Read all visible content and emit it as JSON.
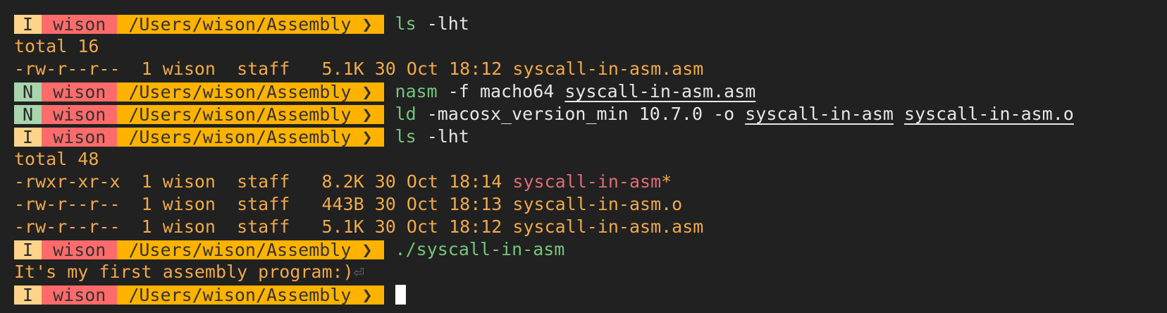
{
  "prompt": {
    "user": "wison",
    "path": "/Users/wison/Assembly",
    "sep": "❯"
  },
  "lines": [
    {
      "type": "prompt",
      "mode": "I",
      "cmd": "ls",
      "args": " -lht"
    },
    {
      "type": "out",
      "text": "total 16"
    },
    {
      "type": "out",
      "text": "-rw-r--r--  1 wison  staff   5.1K 30 Oct 18:12 syscall-in-asm.asm"
    },
    {
      "type": "prompt",
      "mode": "N",
      "cmd": "nasm",
      "args": " -f macho64 ",
      "file1": "syscall-in-asm.asm"
    },
    {
      "type": "prompt",
      "mode": "N",
      "cmd": "ld",
      "args": " -macosx_version_min 10.7.0 -o ",
      "file1": "syscall-in-asm",
      "file2": "syscall-in-asm.o"
    },
    {
      "type": "prompt",
      "mode": "I",
      "cmd": "ls",
      "args": " -lht"
    },
    {
      "type": "out",
      "text": "total 48"
    },
    {
      "type": "listing-exe",
      "prefix": "-rwxr-xr-x  1 wison  staff   8.2K 30 Oct 18:14 ",
      "name": "syscall-in-asm",
      "suffix": "*"
    },
    {
      "type": "out",
      "text": "-rw-r--r--  1 wison  staff   443B 30 Oct 18:13 syscall-in-asm.o"
    },
    {
      "type": "out",
      "text": "-rw-r--r--  1 wison  staff   5.1K 30 Oct 18:12 syscall-in-asm.asm"
    },
    {
      "type": "prompt",
      "mode": "I",
      "cmd": "./syscall-in-asm",
      "args": ""
    },
    {
      "type": "out",
      "text": "It's my first assembly program:)",
      "ret": "⏎"
    },
    {
      "type": "prompt",
      "mode": "I",
      "cursor": true
    }
  ]
}
